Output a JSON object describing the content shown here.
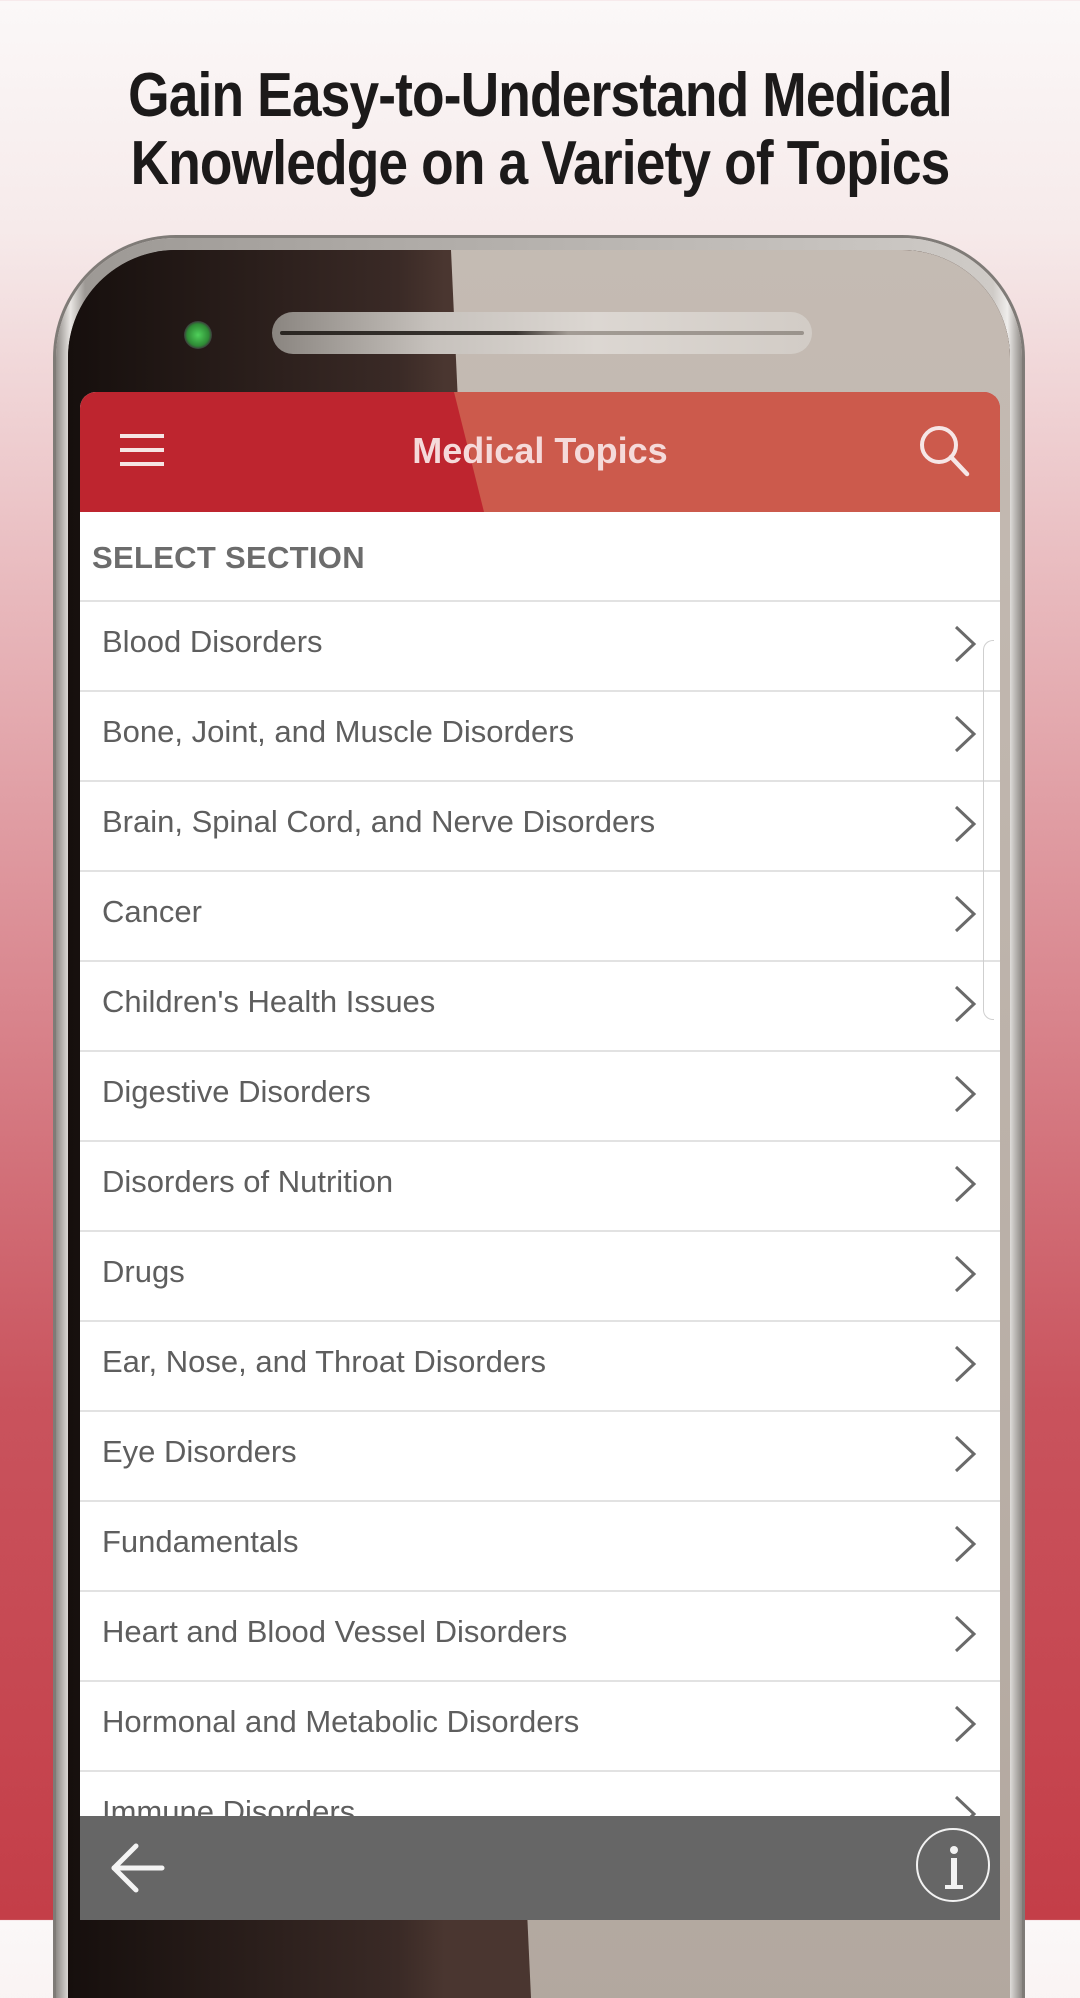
{
  "promo": {
    "headline_line1": "Gain Easy-to-Understand Medical",
    "headline_line2": "Knowledge on a Variety of Topics"
  },
  "app_bar": {
    "title": "Medical Topics",
    "menu_icon": "hamburger-menu-icon",
    "search_icon": "search-icon",
    "color": "#be252f"
  },
  "section": {
    "label": "SELECT SECTION"
  },
  "topics": [
    {
      "label": "Blood Disorders"
    },
    {
      "label": "Bone, Joint, and Muscle Disorders"
    },
    {
      "label": "Brain, Spinal Cord, and Nerve Disorders"
    },
    {
      "label": "Cancer"
    },
    {
      "label": "Children's Health Issues"
    },
    {
      "label": "Digestive Disorders"
    },
    {
      "label": "Disorders of Nutrition"
    },
    {
      "label": "Drugs"
    },
    {
      "label": "Ear, Nose, and Throat Disorders"
    },
    {
      "label": "Eye Disorders"
    },
    {
      "label": "Fundamentals"
    },
    {
      "label": "Heart and Blood Vessel Disorders"
    },
    {
      "label": "Hormonal and Metabolic Disorders"
    },
    {
      "label": "Immune Disorders"
    }
  ],
  "bottom_bar": {
    "back_icon": "back-arrow-icon",
    "info_icon": "info-icon",
    "color": "#666666"
  }
}
